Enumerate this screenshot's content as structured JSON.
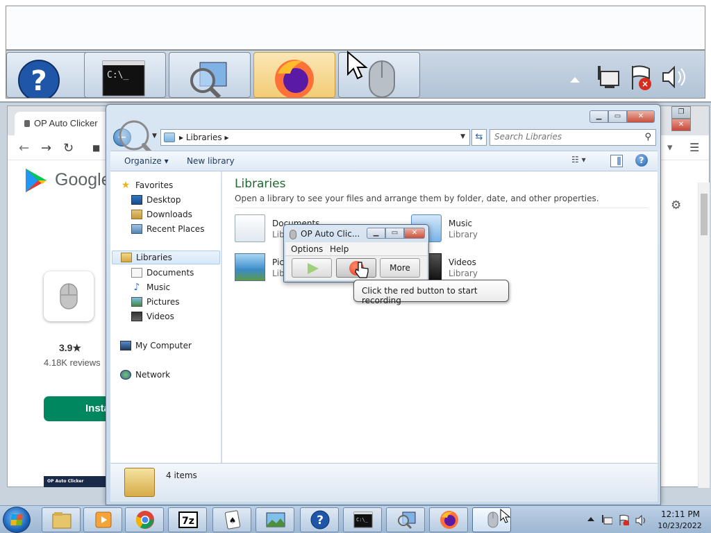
{
  "zoom_preview": {
    "buttons": [
      "help-icon",
      "cmd-icon",
      "explorer-search-icon",
      "firefox-icon",
      "mouse-icon"
    ],
    "tray_icons": [
      "show-hidden-icons-icon",
      "network-icon",
      "action-center-flag-icon",
      "volume-icon"
    ]
  },
  "browser": {
    "tab_title": "OP Auto Clicker",
    "brand": "Google",
    "rating": "3.9★",
    "reviews": "4.18K reviews",
    "install_label": "Insta",
    "thumbnail_text": "OP Auto Clicker"
  },
  "explorer": {
    "address_path": "Libraries",
    "search_placeholder": "Search Libraries",
    "toolbar": {
      "organize": "Organize",
      "new_library": "New library"
    },
    "nav": {
      "favorites": "Favorites",
      "desktop": "Desktop",
      "downloads": "Downloads",
      "recent_places": "Recent Places",
      "libraries": "Libraries",
      "documents": "Documents",
      "music": "Music",
      "pictures": "Pictures",
      "videos": "Videos",
      "my_computer": "My Computer",
      "network": "Network"
    },
    "content": {
      "title": "Libraries",
      "description": "Open a library to see your files and arrange them by folder, date, and other properties.",
      "items": [
        {
          "name": "Documents",
          "type": "Library"
        },
        {
          "name": "Music",
          "type": "Library"
        },
        {
          "name": "Pictures",
          "type": "Library"
        },
        {
          "name": "Videos",
          "type": "Library"
        }
      ]
    },
    "details": "4 items"
  },
  "clicker": {
    "title": "OP Auto Clic...",
    "menu": {
      "options": "Options",
      "help": "Help"
    },
    "more_label": "More",
    "tooltip": "Click the red button to start recording"
  },
  "taskbar": {
    "items": [
      "explorer-icon",
      "media-player-icon",
      "chrome-icon",
      "7zip-icon",
      "solitaire-icon",
      "photo-viewer-icon",
      "help-icon",
      "cmd-icon",
      "explorer-search-icon",
      "firefox-icon",
      "mouse-icon"
    ],
    "time": "12:11 PM",
    "date": "10/23/2022"
  }
}
